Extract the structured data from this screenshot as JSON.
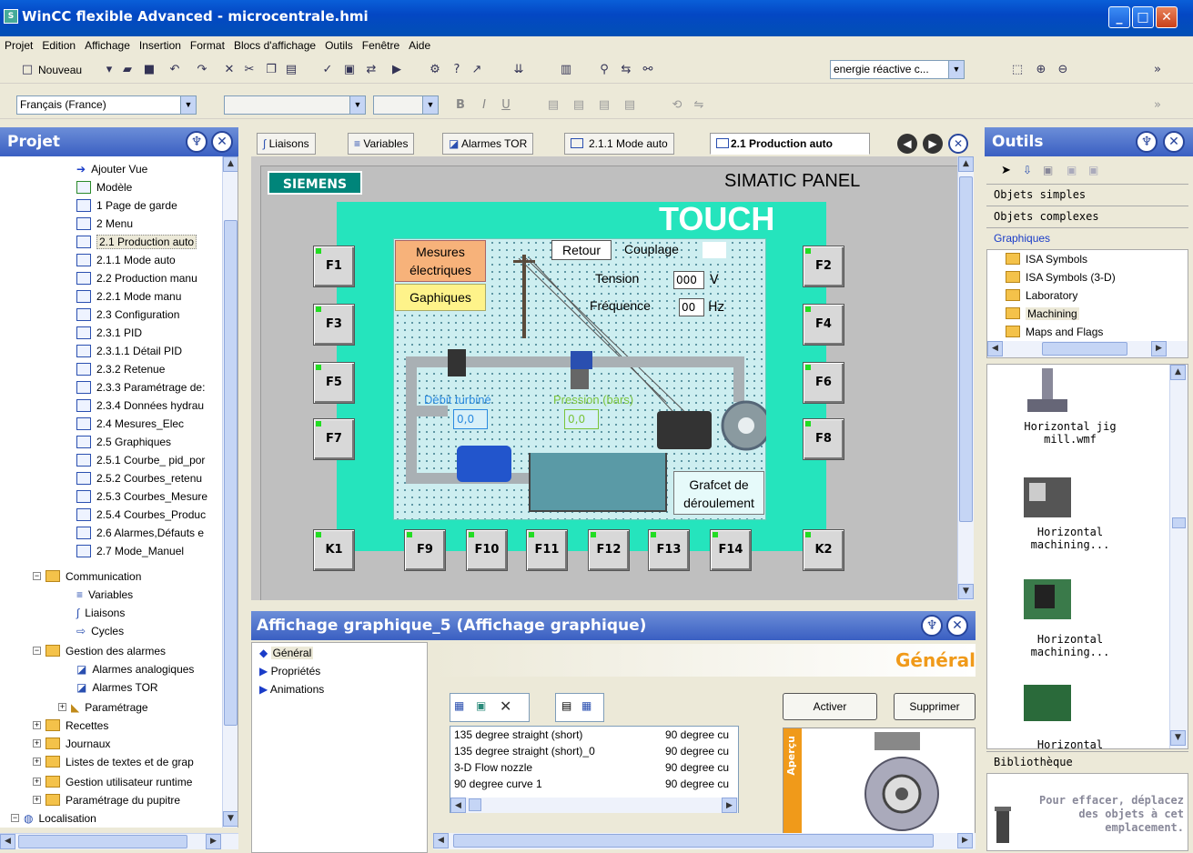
{
  "window": {
    "title": "WinCC flexible Advanced - microcentrale.hmi",
    "min": "_",
    "max": "□",
    "close": "✕"
  },
  "menu": [
    "Projet",
    "Edition",
    "Affichage",
    "Insertion",
    "Format",
    "Blocs d'affichage",
    "Outils",
    "Fenêtre",
    "Aide"
  ],
  "toolbar": {
    "new_label": "Nouveau",
    "search_combo": "energie réactive c...",
    "language_combo": "Français (France)",
    "bold": "B",
    "italic": "I",
    "underline": "U"
  },
  "project": {
    "title": "Projet",
    "items": [
      "Ajouter Vue",
      "Modèle",
      "1 Page de garde",
      "2 Menu",
      "2.1 Production auto",
      "2.1.1 Mode auto",
      "2.2 Production manu",
      "2.2.1 Mode manu",
      "2.3 Configuration",
      "2.3.1 PID",
      "2.3.1.1 Détail PID",
      "2.3.2 Retenue",
      "2.3.3 Paramétrage de:",
      "2.3.4 Données hydrau",
      "2.4 Mesures_Elec",
      "2.5 Graphiques",
      "2.5.1 Courbe_ pid_por",
      "2.5.2 Courbes_retenu",
      "2.5.3 Courbes_Mesure",
      "2.5.4 Courbes_Produc",
      "2.6 Alarmes,Défauts e",
      "2.7 Mode_Manuel"
    ],
    "communication": "Communication",
    "comm_items": [
      "Variables",
      "Liaisons",
      "Cycles"
    ],
    "alarms": "Gestion des alarmes",
    "alarm_items": [
      "Alarmes analogiques",
      "Alarmes TOR",
      "Paramétrage"
    ],
    "tail": [
      "Recettes",
      "Journaux",
      "Listes de textes et de grap",
      "Gestion utilisateur runtime",
      "Paramétrage du pupitre"
    ],
    "localisation": "Localisation"
  },
  "tabs": [
    "Liaisons",
    "Variables",
    "Alarmes TOR",
    "2.1.1 Mode auto",
    "2.1 Production auto"
  ],
  "panel": {
    "brand": "SIEMENS",
    "model": "SIMATIC PANEL",
    "touch": "TOUCH",
    "mesures": "Mesures électriques",
    "graphiques": "Gaphiques",
    "retour": "Retour",
    "couplage": "Couplage",
    "tension_label": "Tension",
    "tension_value": "000",
    "tension_unit": "V",
    "freq_label": "Fréquence",
    "freq_value": "00",
    "freq_unit": "Hz",
    "debit_label": "Débit turbiné",
    "pression_label": "Pression (bars)",
    "debit_value": "0,0",
    "pression_value": "0,0",
    "grafcet": "Grafcet de déroulement",
    "left_keys": [
      "F1",
      "F3",
      "F5",
      "F7"
    ],
    "right_keys": [
      "F2",
      "F4",
      "F6",
      "F8"
    ],
    "bottom_keys": [
      "K1",
      "F9",
      "F10",
      "F11",
      "F12",
      "F13",
      "F14",
      "K2"
    ]
  },
  "props": {
    "title": "Affichage graphique_5 (Affichage graphique)",
    "nav": [
      "Général",
      "Propriétés",
      "Animations"
    ],
    "section": "Général",
    "list_left": [
      "135 degree straight (short)",
      "135 degree straight (short)_0",
      "3-D Flow nozzle",
      "90 degree curve 1"
    ],
    "list_right": [
      "90 degree cu",
      "90 degree cu",
      "90 degree cu",
      "90 degree cu"
    ],
    "activer": "Activer",
    "supprimer": "Supprimer",
    "apercu": "Aperçu"
  },
  "tools": {
    "title": "Outils",
    "sections": [
      "Objets simples",
      "Objets complexes",
      "Graphiques"
    ],
    "folders": [
      "ISA Symbols",
      "ISA Symbols (3-D)",
      "Laboratory",
      "Machining",
      "Maps and Flags"
    ],
    "lib_items": [
      "Horizontal jig mill.wmf",
      "Horizontal machining...",
      "Horizontal machining...",
      "Horizontal"
    ],
    "bibliotheque": "Bibliothèque",
    "drop_hint": "Pour effacer, déplacez des objets à cet emplacement."
  }
}
